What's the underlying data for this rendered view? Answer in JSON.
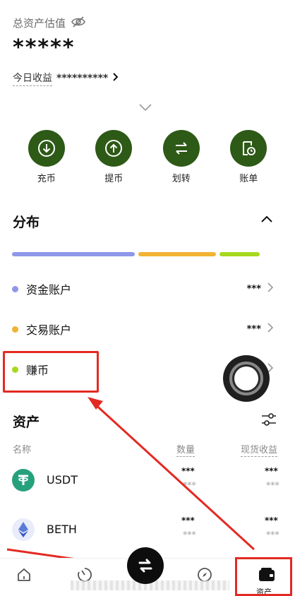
{
  "header": {
    "total_label": "总资产估值",
    "total_value": "*****",
    "today_label": "今日收益",
    "today_value": "**********"
  },
  "actions": [
    {
      "label": "充币",
      "icon": "deposit-icon"
    },
    {
      "label": "提币",
      "icon": "withdraw-icon"
    },
    {
      "label": "划转",
      "icon": "transfer-icon"
    },
    {
      "label": "账单",
      "icon": "bill-icon"
    }
  ],
  "distribution": {
    "title": "分布",
    "bars": [
      {
        "color": "#8e97e8",
        "share": 0.46
      },
      {
        "color": "#f2b233",
        "share": 0.29
      },
      {
        "color": "#a6d91e",
        "share": 0.15
      }
    ],
    "accounts": [
      {
        "name": "资金账户",
        "value": "***",
        "color": "#8e97e8"
      },
      {
        "name": "交易账户",
        "value": "***",
        "color": "#f2b233"
      },
      {
        "name": "赚币",
        "value": "",
        "color": "#a6d91e"
      }
    ]
  },
  "assets": {
    "title": "资产",
    "col_name": "名称",
    "col_qty": "数量",
    "col_pnl": "现货收益",
    "rows": [
      {
        "coin": "USDT",
        "qty_top": "***",
        "qty_bot": "***",
        "pnl_top": "***",
        "pnl_bot": "***",
        "color": "#26a17b"
      },
      {
        "coin": "BETH",
        "qty_top": "***",
        "qty_bot": "***",
        "pnl_top": "***",
        "pnl_bot": "***",
        "color": "#e8ecfb"
      }
    ]
  },
  "nav": {
    "assets_label": "资产"
  },
  "colors": {
    "action_green": "#2d5a16",
    "highlight_red": "#e32a22"
  }
}
